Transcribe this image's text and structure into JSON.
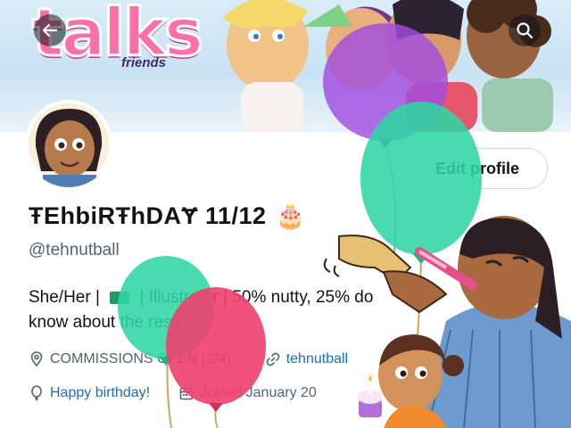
{
  "header": {
    "logo_text": "talks",
    "logo_subtitle": "friends",
    "back_icon": "arrow-left-icon",
    "search_icon": "search-icon"
  },
  "profile": {
    "display_name": "ŦEhbiRŦhDAɎ 11/12",
    "name_emoji": "🎂",
    "handle": "@tehnutball",
    "edit_label": "Edit profile",
    "bio_line1_a": "She/Her | ",
    "bio_line1_b": " | Illustrator | 50% nutty, 25% ",
    "bio_line1_c": "do",
    "bio_line2": "know about the rest!",
    "location": "COMMISSIONS OPEN (2/4)",
    "website": "tehnutball",
    "birthday": "Happy birthday!",
    "joined": "Joined January 20"
  },
  "colors": {
    "accent_link": "#1d6fb8",
    "muted": "#536471",
    "balloon_purple": "#a14de0",
    "balloon_green": "#2fd6a4",
    "balloon_pink": "#ef3f6e"
  }
}
